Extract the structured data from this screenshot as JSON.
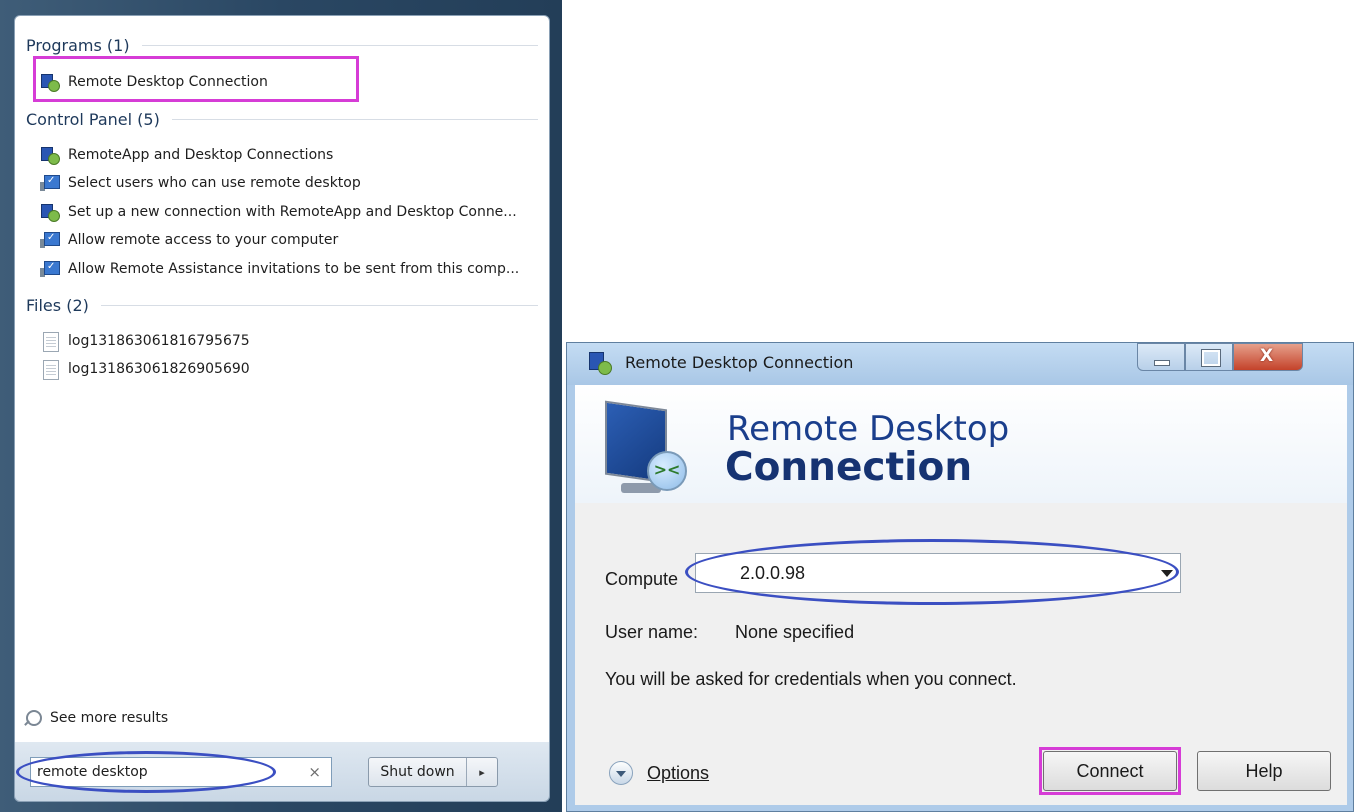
{
  "start_menu": {
    "sections": {
      "programs": {
        "header": "Programs (1)",
        "items": [
          "Remote Desktop Connection"
        ]
      },
      "control_panel": {
        "header": "Control Panel (5)",
        "items": [
          "RemoteApp and Desktop Connections",
          "Select users who can use remote desktop",
          "Set up a new connection with RemoteApp and Desktop Conne...",
          "Allow remote access to your computer",
          "Allow Remote Assistance invitations to be sent from this comp..."
        ]
      },
      "files": {
        "header": "Files (2)",
        "items": [
          "log131863061816795675",
          "log131863061826905690"
        ]
      }
    },
    "see_more": "See more results",
    "search_value": "remote desktop",
    "search_clear": "×",
    "shutdown_label": "Shut down",
    "shutdown_arrow": "▸"
  },
  "rdc": {
    "window_title": "Remote Desktop Connection",
    "close_glyph": "X",
    "banner_line1": "Remote Desktop",
    "banner_line2": "Connection",
    "computer_label": "Compute",
    "computer_value": "2.0.0.98",
    "username_label": "User name:",
    "username_value": "None specified",
    "note": "You will be asked for credentials when you connect.",
    "options_label": "Options",
    "connect_label": "Connect",
    "help_label": "Help"
  },
  "colors": {
    "highlight_magenta": "#d63cd6",
    "highlight_blue": "#3b4fc2",
    "section_header": "#1e395b"
  }
}
